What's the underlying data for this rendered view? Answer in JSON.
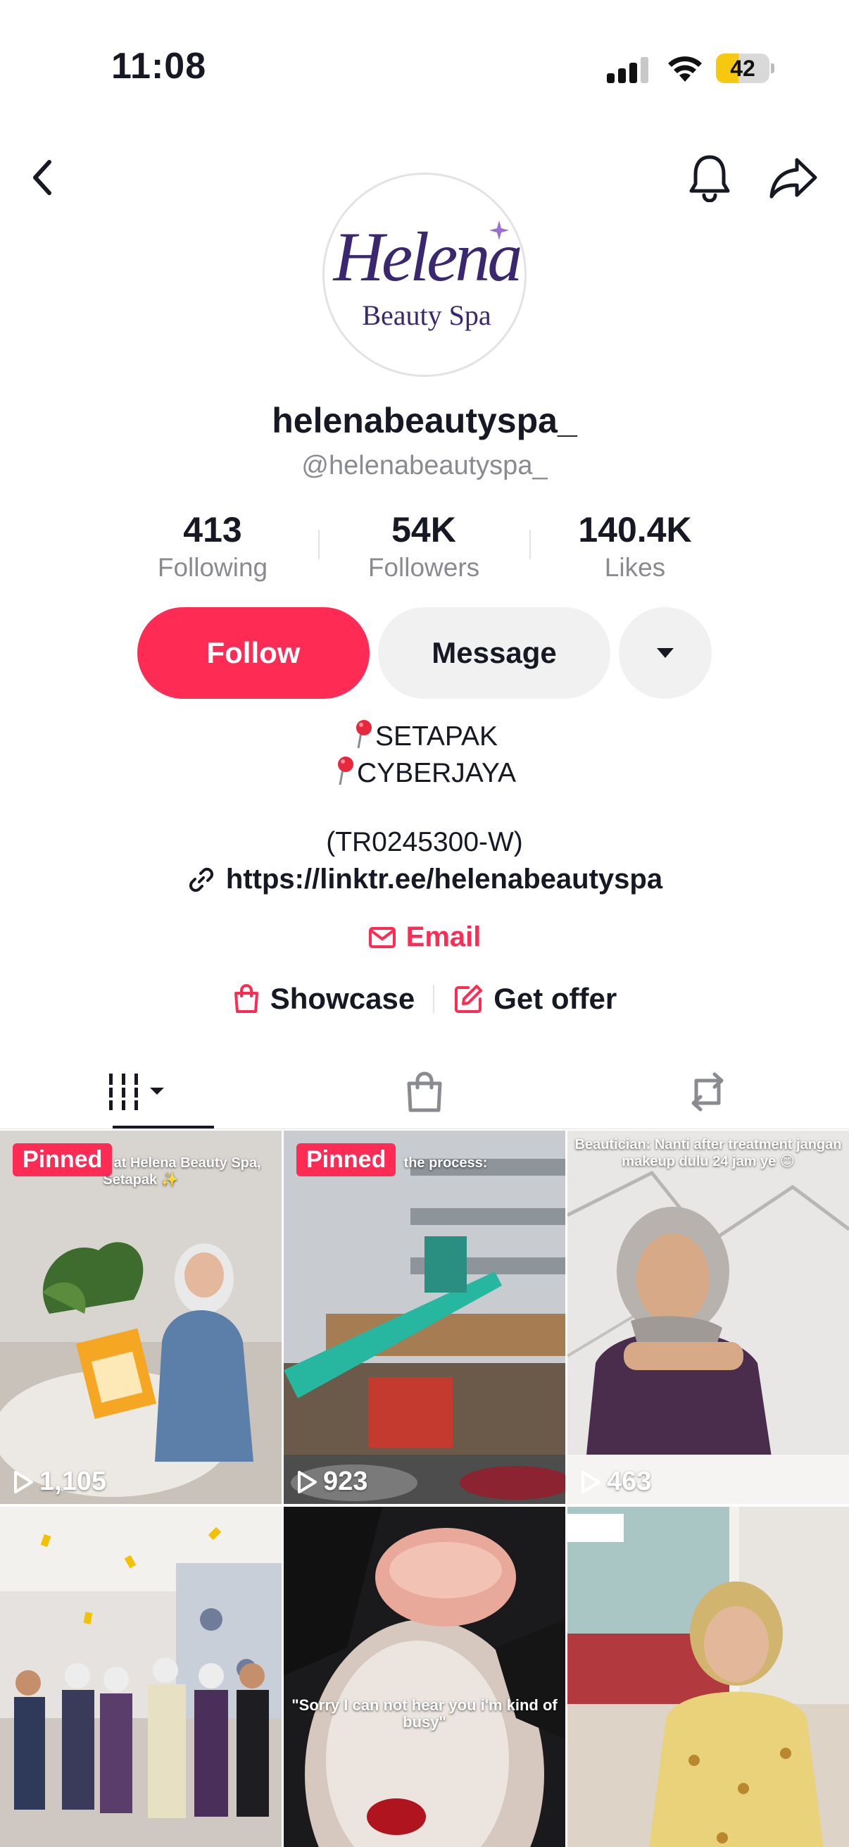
{
  "status_bar": {
    "time": "11:08",
    "battery_level": 42,
    "battery_label": "42"
  },
  "nav": {
    "back_icon": "chevron-left-icon",
    "bell_icon": "bell-icon",
    "share_icon": "share-arrow-icon"
  },
  "profile": {
    "logo_script": "Helena",
    "logo_subtitle": "Beauty Spa",
    "display_name": "helenabeautyspa_",
    "handle": "@helenabeautyspa_"
  },
  "stats": [
    {
      "value": "413",
      "label": "Following"
    },
    {
      "value": "54K",
      "label": "Followers"
    },
    {
      "value": "140.4K",
      "label": "Likes"
    }
  ],
  "actions": {
    "follow": "Follow",
    "message": "Message"
  },
  "bio": {
    "line1": "SETAPAK",
    "line2": "CYBERJAYA",
    "registration": "(TR0245300-W)",
    "link": "https://linktr.ee/helenabeautyspa",
    "email": "Email"
  },
  "shortcuts": {
    "showcase": "Showcase",
    "get_offer": "Get offer"
  },
  "tabs": [
    "videos-grid-icon",
    "shopping-bag-icon",
    "repost-icon"
  ],
  "colors": {
    "accent": "#fe2c55",
    "text": "#161823",
    "muted": "#8a8b91",
    "logo_purple": "#3b2670"
  },
  "videos": [
    {
      "pinned": "Pinned",
      "views": "1,105",
      "caption": "of pampering at Helena Beauty Spa, Setapak ✨"
    },
    {
      "pinned": "Pinned",
      "views": "923",
      "caption": "the process:"
    },
    {
      "pinned": "",
      "views": "463",
      "caption": "Beautician: Nanti after treatment jangan makeup dulu 24 jam ye 😊"
    },
    {
      "pinned": "",
      "views": "",
      "caption": ""
    },
    {
      "pinned": "",
      "views": "",
      "caption": "\"Sorry I can not hear you i'm kind of busy\""
    },
    {
      "pinned": "",
      "views": "",
      "caption": ""
    }
  ]
}
